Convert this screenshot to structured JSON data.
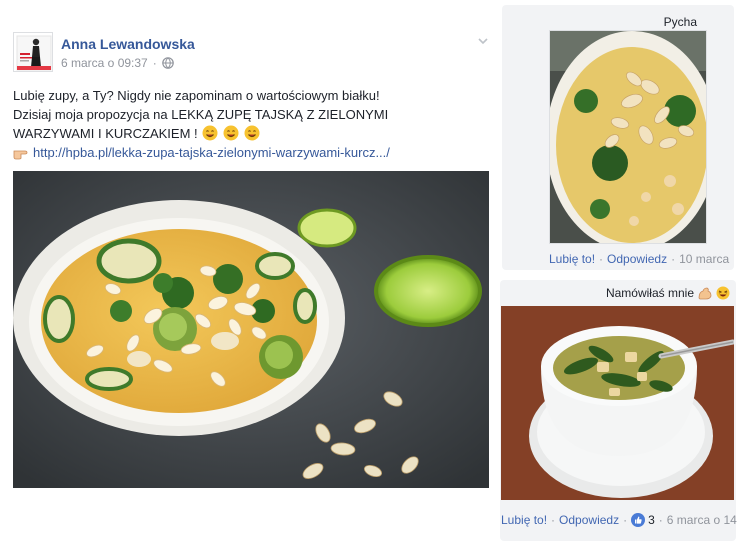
{
  "post": {
    "author": "Anna Lewandowska",
    "date": "6 marca o 09:37",
    "text_lines": [
      "Lubię zupy, a Ty? Nigdy nie zapominam o wartościowym białku!",
      "Dzisiaj moja propozycja na LEKKĄ ZUPĘ TAJSKĄ Z ZIELONYMI",
      "WARZYWAMI I KURCZAKIEM !"
    ],
    "link": "http://hpba.pl/lekka-zupa-tajska-zielonymi-warzywami-kurcz.../"
  },
  "comments": [
    {
      "text": "Pycha",
      "like_label": "Lubię to!",
      "reply_label": "Odpowiedz",
      "time": "10 marca"
    },
    {
      "text": "Namówiłaś mnie",
      "like_label": "Lubię to!",
      "reply_label": "Odpowiedz",
      "likes": "3",
      "time": "6 marca o 14"
    }
  ],
  "colors": {
    "link": "#365899",
    "action": "#4267b2",
    "meta": "#90949c",
    "comment_bg": "#f2f3f5"
  },
  "icons": [
    "chevron-down-icon",
    "globe-icon",
    "smiley-emoji",
    "pointing-hand-emoji",
    "flexed-biceps-emoji",
    "laughing-emoji",
    "like-thumb-icon"
  ]
}
